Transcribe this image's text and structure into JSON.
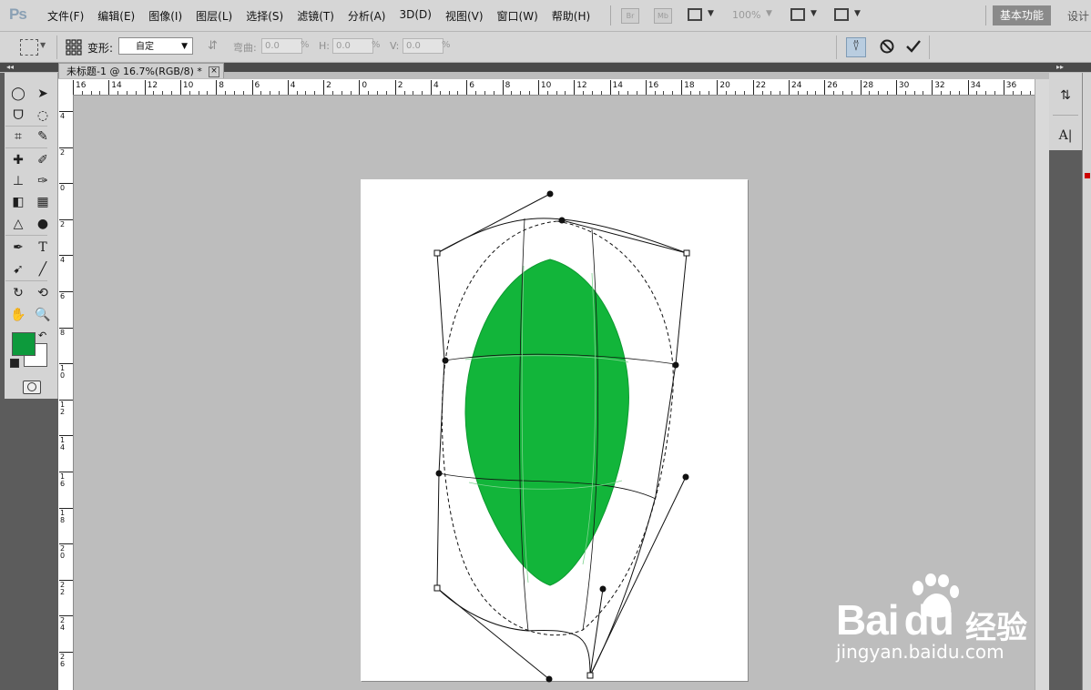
{
  "app": {
    "logo": "Ps"
  },
  "menu": [
    "文件(F)",
    "编辑(E)",
    "图像(I)",
    "图层(L)",
    "选择(S)",
    "滤镜(T)",
    "分析(A)",
    "3D(D)",
    "视图(V)",
    "窗口(W)",
    "帮助(H)"
  ],
  "menubar": {
    "bridge_badge": "Br",
    "minibridge_badge": "Mb",
    "zoom": "100%",
    "workspace": "基本功能",
    "design": "设计"
  },
  "options": {
    "warp_label": "变形:",
    "warp_value": "自定",
    "bend_label": "弯曲:",
    "bend_value": "0.0",
    "h_label": "H:",
    "h_value": "0.0",
    "v_label": "V:",
    "v_value": "0.0",
    "pct": "%"
  },
  "document": {
    "tab_title": "未标题-1 @ 16.7%(RGB/8) *",
    "close": "×"
  },
  "ruler": {
    "top_labels": [
      "16",
      "14",
      "12",
      "10",
      "8",
      "6",
      "4",
      "2",
      "0",
      "2",
      "4",
      "6",
      "8",
      "10",
      "12",
      "14",
      "16",
      "18",
      "20",
      "22",
      "24",
      "26",
      "28",
      "30",
      "32",
      "34",
      "36"
    ],
    "left_labels": [
      "4",
      "2",
      "0",
      "2",
      "4",
      "6",
      "8",
      "1 0",
      "1 2",
      "1 4",
      "1 6",
      "1 8",
      "2 0",
      "2 2",
      "2 4",
      "2 6"
    ]
  },
  "colors": {
    "foreground": "#0d9a3c",
    "background": "#ffffff",
    "shape_fill": "#12b53a"
  },
  "tools": [
    "marquee-icon",
    "move-icon",
    "lasso-icon",
    "quick-select-icon",
    "crop-icon",
    "eyedropper-icon",
    "healing-icon",
    "brush-icon",
    "stamp-icon",
    "history-brush-icon",
    "eraser-icon",
    "gradient-icon",
    "blur-icon",
    "dodge-icon",
    "pen-icon",
    "type-icon",
    "path-select-icon",
    "line-icon",
    "3d-rotate-icon",
    "3d-orbit-icon",
    "hand-icon",
    "zoom-icon"
  ],
  "watermark": {
    "brand": "Bai",
    "brand2": "du",
    "cn": "经验",
    "url": "jingyan.baidu.com"
  }
}
